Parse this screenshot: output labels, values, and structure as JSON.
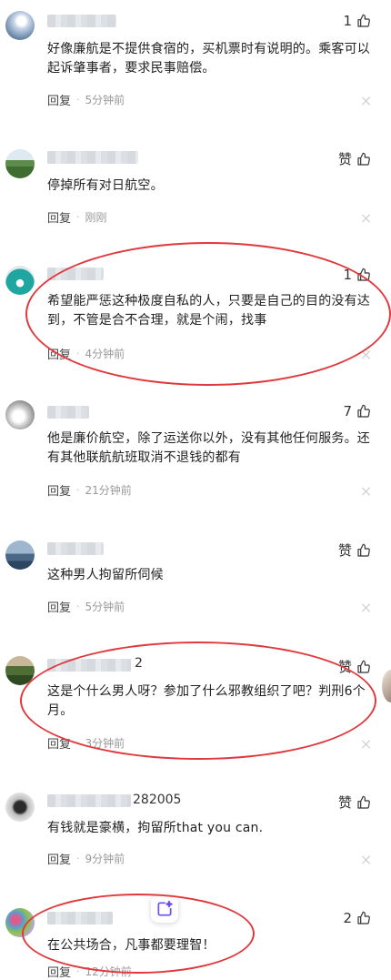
{
  "comments": [
    {
      "likes": "1",
      "text": "好像廉航是不提供食宿的，买机票时有说明的。乘客可以起诉肇事者，要求民事赔偿。",
      "reply": "回复",
      "time": "5分钟前"
    },
    {
      "likes": "赞",
      "text": "停掉所有对日航空。",
      "reply": "回复",
      "time": "刚刚"
    },
    {
      "likes": "1",
      "text": "希望能严惩这种极度自私的人，只要是自己的目的没有达到，不管是合不合理，就是个闹，找事",
      "reply": "回复",
      "time": "4分钟前"
    },
    {
      "likes": "7",
      "text": "他是廉价航空，除了运送你以外，没有其他任何服务。还有其他联航航班取消不退钱的都有",
      "reply": "回复",
      "time": "21分钟前"
    },
    {
      "likes": "赞",
      "text": "这种男人拘留所伺候",
      "reply": "回复",
      "time": "5分钟前"
    },
    {
      "username_tail": "2",
      "likes": "赞",
      "text": "这是个什么男人呀？参加了什么邪教组织了吧？判刑6个月。",
      "reply": "回复",
      "time": "3分钟前"
    },
    {
      "username_tail": "282005",
      "likes": "赞",
      "text": "有钱就是豪横，拘留所that you can.",
      "reply": "回复",
      "time": "9分钟前"
    },
    {
      "likes": "2",
      "text": "在公共场合，凡事都要理智！",
      "reply": "回复",
      "time": "12分钟前"
    }
  ],
  "icons": {
    "like": "thumbs-up-icon",
    "dismiss": "close-icon",
    "floating": "ai-sparkle-icon"
  },
  "colors": {
    "highlight": "#e0393d",
    "meta_text": "#9a9a9a"
  }
}
